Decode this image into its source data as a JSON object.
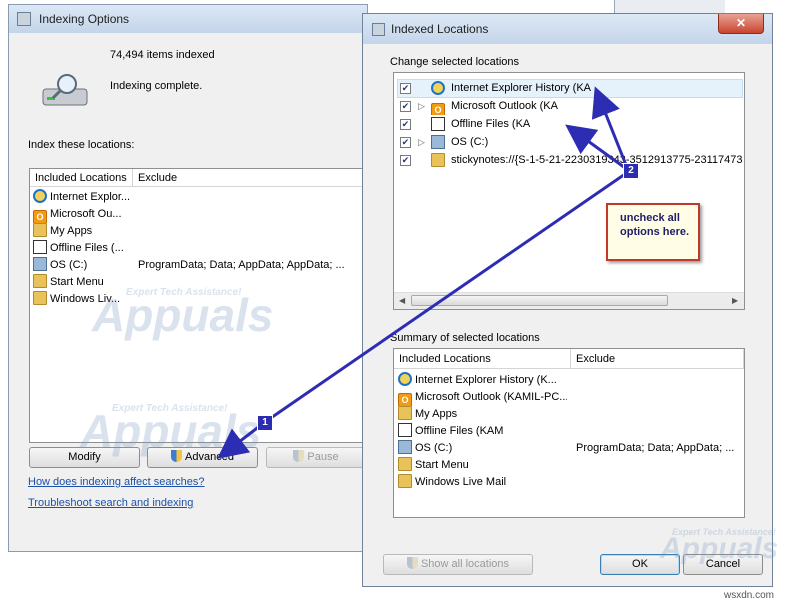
{
  "indexing_options": {
    "title": "Indexing Options",
    "items_indexed": "74,494 items indexed",
    "status": "Indexing complete.",
    "index_label": "Index these locations:",
    "columns": [
      "Included Locations",
      "Exclude"
    ],
    "rows": [
      {
        "icon": "ie-icon",
        "name": "Internet Explor...",
        "exclude": ""
      },
      {
        "icon": "outlook-icon",
        "name": "Microsoft Ou...",
        "exclude": ""
      },
      {
        "icon": "folder-icon",
        "name": "My Apps",
        "exclude": ""
      },
      {
        "icon": "offline-files-icon",
        "name": "Offline Files (...",
        "exclude": ""
      },
      {
        "icon": "drive-icon",
        "name": "OS (C:)",
        "exclude": "ProgramData; Data; AppData; AppData; ..."
      },
      {
        "icon": "folder-icon",
        "name": "Start Menu",
        "exclude": ""
      },
      {
        "icon": "folder-icon",
        "name": "Windows Liv...",
        "exclude": ""
      }
    ],
    "buttons": {
      "modify": "Modify",
      "advanced": "Advanced",
      "pause": "Pause"
    },
    "links": {
      "how": "How does indexing affect searches?",
      "troubleshoot": "Troubleshoot search and indexing"
    }
  },
  "indexed_locations": {
    "title": "Indexed Locations",
    "change_label": "Change selected locations",
    "tree": [
      {
        "icon": "ie-icon",
        "label": "Internet Explorer History (KA",
        "checked": true,
        "expander": false
      },
      {
        "icon": "outlook-icon",
        "label": "Microsoft Outlook (KA",
        "checked": true,
        "expander": true
      },
      {
        "icon": "offline-files-icon",
        "label": "Offline Files (KA",
        "checked": true,
        "expander": false
      },
      {
        "icon": "drive-icon",
        "label": "OS (C:)",
        "checked": true,
        "expander": true
      },
      {
        "icon": "folder-icon",
        "label": "stickynotes://{S-1-5-21-2230319343-3512913775-23117473",
        "checked": true,
        "expander": false
      }
    ],
    "summary_label": "Summary of selected locations",
    "columns": [
      "Included Locations",
      "Exclude"
    ],
    "rows": [
      {
        "icon": "ie-icon",
        "name": "Internet Explorer History (K...",
        "exclude": ""
      },
      {
        "icon": "outlook-icon",
        "name": "Microsoft Outlook (KAMIL-PC...",
        "exclude": ""
      },
      {
        "icon": "folder-icon",
        "name": "My Apps",
        "exclude": ""
      },
      {
        "icon": "offline-files-icon",
        "name": "Offline Files (KAM",
        "exclude": ""
      },
      {
        "icon": "drive-icon",
        "name": "OS (C:)",
        "exclude": "ProgramData; Data; AppData; ..."
      },
      {
        "icon": "folder-icon",
        "name": "Start Menu",
        "exclude": ""
      },
      {
        "icon": "folder-icon",
        "name": "Windows Live Mail",
        "exclude": ""
      }
    ],
    "buttons": {
      "show_all": "Show all locations",
      "ok": "OK",
      "cancel": "Cancel"
    },
    "close_glyph": "✕"
  },
  "annotations": {
    "callout": "uncheck all options here.",
    "badge1": "1",
    "badge2": "2",
    "arrow_color": "#2d2db3"
  },
  "watermark": {
    "brand": "Appuals",
    "tagline": "Expert Tech Assistance!"
  },
  "footer_mark": "wsxdn.com"
}
